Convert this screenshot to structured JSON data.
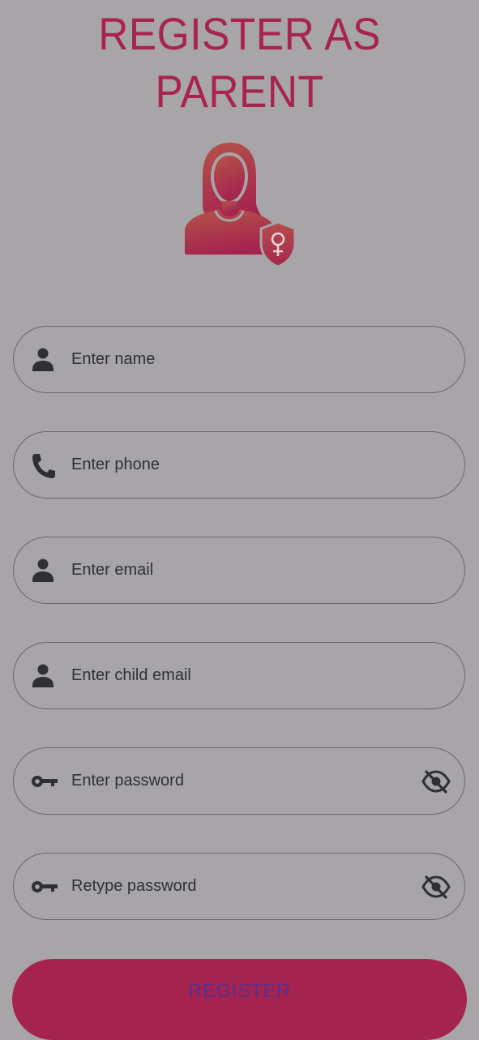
{
  "header": {
    "title_line1": "REGISTER AS",
    "title_line2": "PARENT"
  },
  "avatar": {
    "icon": "female-parent-shield-icon"
  },
  "form": {
    "name": {
      "placeholder": "Enter name",
      "icon": "person-icon"
    },
    "phone": {
      "placeholder": "Enter phone",
      "icon": "phone-icon"
    },
    "email": {
      "placeholder": "Enter email",
      "icon": "person-icon"
    },
    "child_email": {
      "placeholder": "Enter child email",
      "icon": "person-icon"
    },
    "password": {
      "placeholder": "Enter password",
      "icon": "key-icon",
      "toggle_icon": "eye-off-icon"
    },
    "retype_password": {
      "placeholder": "Retype password",
      "icon": "key-icon",
      "toggle_icon": "eye-off-icon"
    }
  },
  "register_button": {
    "label": "REGISTER"
  },
  "colors": {
    "background": "#a7a5a8",
    "accent": "#a8244f",
    "text": "#313033",
    "border": "#6a686b"
  }
}
